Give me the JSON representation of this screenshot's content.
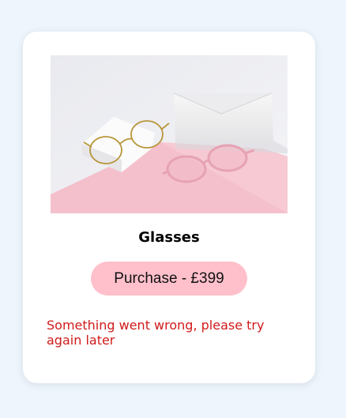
{
  "product": {
    "image_alt": "Two pairs of glasses on a pink and white background",
    "name": "Glasses",
    "purchase_label": "Purchase - £399",
    "error_message": "Something went wrong, please try again later"
  },
  "colors": {
    "page_bg": "#eef5fd",
    "card_bg": "#ffffff",
    "button_bg": "#ffc0cb",
    "error_text": "#d11a1a"
  }
}
